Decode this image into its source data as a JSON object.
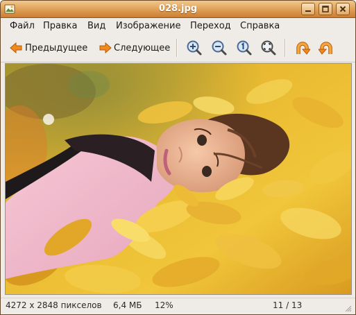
{
  "window": {
    "title": "028.jpg",
    "colors": {
      "titlebar": "#e3a55c",
      "accent_orange": "#f08a1c"
    }
  },
  "menu": [
    {
      "label": "Файл"
    },
    {
      "label": "Правка"
    },
    {
      "label": "Вид"
    },
    {
      "label": "Изображение"
    },
    {
      "label": "Переход"
    },
    {
      "label": "Справка"
    }
  ],
  "toolbar": {
    "prev_label": "Предыдущее",
    "next_label": "Следующее",
    "icons": [
      "arrow-left-icon",
      "arrow-right-icon",
      "zoom-in-icon",
      "zoom-out-icon",
      "zoom-normal-icon",
      "zoom-fit-icon",
      "rotate-left-icon",
      "rotate-right-icon"
    ]
  },
  "status": {
    "dimensions": "4272 x 2848 пикселов",
    "size": "6,4 МБ",
    "zoom": "12%",
    "position": "11 / 13"
  }
}
